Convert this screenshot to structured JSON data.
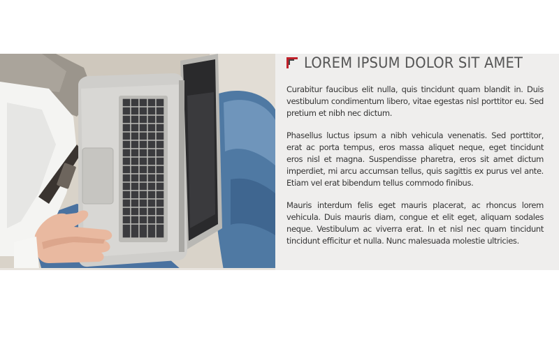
{
  "article": {
    "title": "LOREM IPSUM DOLOR SIT AMET",
    "paragraphs": [
      "Curabitur faucibus elit nulla, quis tincidunt quam blandit in. Duis vestibulum condimentum libero, vitae egestas nisl porttitor eu. Sed pretium et nibh nec dictum.",
      "Phasellus luctus ipsum a nibh vehicula venenatis. Sed porttitor, erat ac porta tempus, eros massa aliquet neque, eget tincidunt eros nisl et magna. Suspendisse pharetra, eros sit amet dictum imperdiet, mi arcu accumsan tellus, quis sagittis ex purus vel ante. Etiam vel erat bibendum tellus commodo finibus.",
      "Mauris interdum felis eget mauris placerat, ac rhoncus lorem vehicula. Duis mauris diam, congue et elit eget, aliquam sodales neque. Vestibulum ac viverra erat. In et nisl nec quam tincidunt tincidunt efficitur et nulla. Nunc malesuada molestie ultricies."
    ]
  },
  "photo": {
    "subject": "person-with-laptop"
  },
  "colors": {
    "accent": "#c0202a",
    "title": "#555555",
    "body": "#333333",
    "panel": "#efeeed"
  }
}
